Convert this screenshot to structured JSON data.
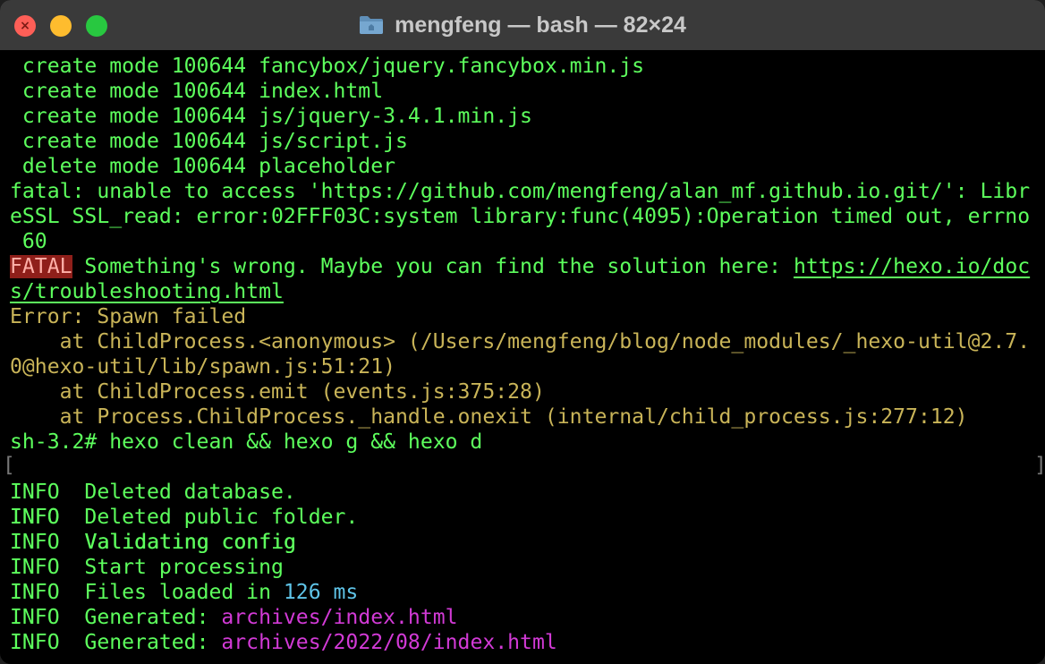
{
  "window": {
    "title": "mengfeng — bash — 82×24",
    "icons": {
      "folder": "folder-icon",
      "close": "close-icon",
      "minimize": "minimize-icon",
      "zoom": "zoom-icon"
    },
    "close_glyph": "×",
    "colors": {
      "green": "#5dff5d",
      "yellow": "#c9b458",
      "fatal_bg": "#8f1f1a",
      "cyan": "#5fc4e8",
      "magenta": "#d23ad6"
    }
  },
  "terminal": {
    "lines": [
      " create mode 100644 fancybox/jquery.fancybox.min.js",
      " create mode 100644 index.html",
      " create mode 100644 js/jquery-3.4.1.min.js",
      " create mode 100644 js/script.js",
      " delete mode 100644 placeholder",
      "fatal: unable to access 'https://github.com/mengfeng/alan_mf.github.io.git/': Libr",
      "eSSL SSL_read: error:02FFF03C:system library:func(4095):Operation timed out, errno",
      " 60"
    ],
    "fatal": {
      "badge": "FATAL",
      "message": " Something's wrong. Maybe you can find the solution here: ",
      "link_part1": "https://hexo.io/doc",
      "link_part2": "s/troubleshooting.html"
    },
    "error_lines": [
      "Error: Spawn failed",
      "    at ChildProcess.<anonymous> (/Users/mengfeng/blog/node_modules/_hexo-util@2.7.",
      "0@hexo-util/lib/spawn.js:51:21)",
      "    at ChildProcess.emit (events.js:375:28)",
      "    at Process.ChildProcess._handle.onexit (internal/child_process.js:277:12)"
    ],
    "prompt": "sh-3.2# hexo clean && hexo g && hexo d",
    "bracket_left": "[",
    "bracket_right": "]",
    "info": [
      {
        "level": "INFO",
        "text": "  Validating config"
      },
      {
        "level": "INFO",
        "text": "  Deleted database."
      },
      {
        "level": "INFO",
        "text": "  Deleted public folder."
      },
      {
        "level": "INFO",
        "text": "  Validating config"
      },
      {
        "level": "INFO",
        "text": "  Start processing"
      }
    ],
    "files_loaded": {
      "level": "INFO",
      "prefix": "  Files loaded in ",
      "value": "126",
      "unit": " ms"
    },
    "generated": [
      {
        "level": "INFO",
        "prefix": "  Generated: ",
        "path": "archives/index.html"
      },
      {
        "level": "INFO",
        "prefix": "  Generated: ",
        "path": "archives/2022/08/index.html"
      }
    ]
  }
}
